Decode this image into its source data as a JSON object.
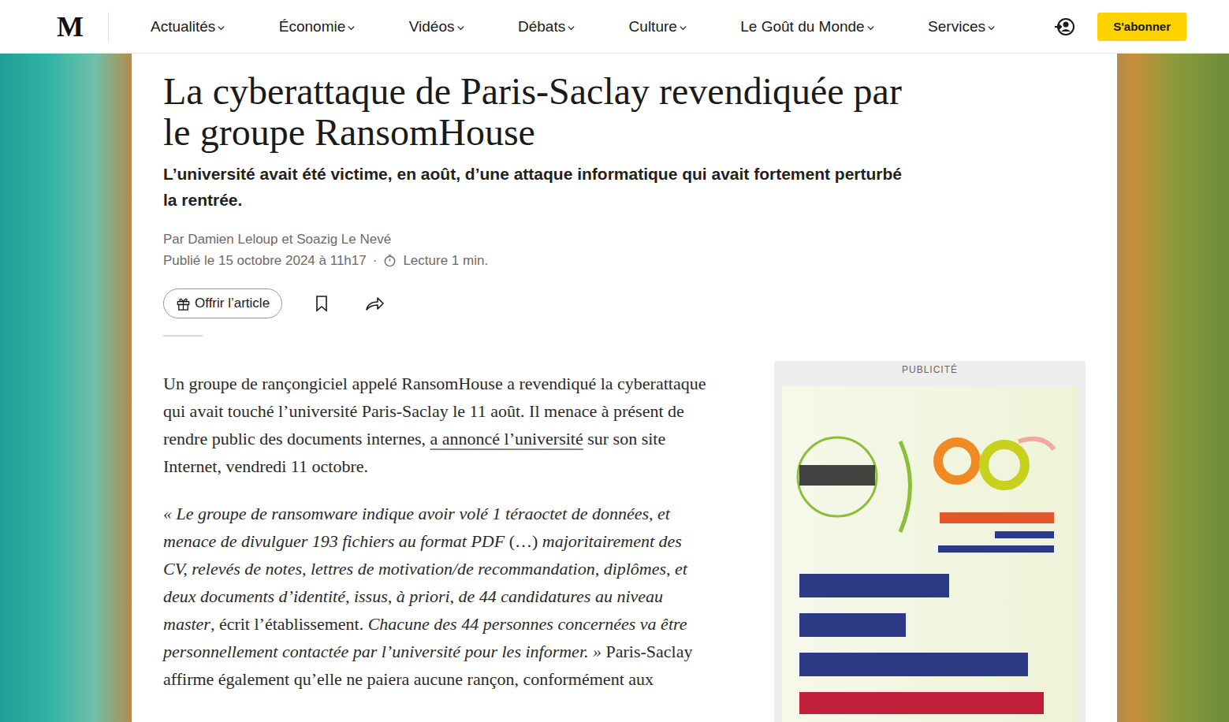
{
  "header": {
    "logo": "M",
    "nav": [
      {
        "label": "Actualités"
      },
      {
        "label": "Économie"
      },
      {
        "label": "Vidéos"
      },
      {
        "label": "Débats"
      },
      {
        "label": "Culture"
      },
      {
        "label": "Le Goût du Monde"
      },
      {
        "label": "Services"
      }
    ],
    "subscribe": "S'abonner"
  },
  "article": {
    "title": "La cyberattaque de Paris-Saclay revendiquée par le groupe RansomHouse",
    "subtitle": "L’université avait été victime, en août, d’une attaque informatique qui avait fortement perturbé la rentrée.",
    "byline": "Par Damien Leloup et Soazig Le Nevé",
    "published": "Publié le 15 octobre 2024 à 11h17",
    "separator": "·",
    "reading": "Lecture 1 min.",
    "gift": "Offrir l’article",
    "paragraphs": [
      {
        "runs": [
          {
            "kind": "plain",
            "text": "Un groupe de rançongiciel appelé RansomHouse a revendiqué la cyberattaque qui avait touché l’université Paris-Saclay le 11 août. Il menace à présent de rendre public des documents internes, "
          },
          {
            "kind": "link",
            "text": "a annoncé l’université"
          },
          {
            "kind": "plain",
            "text": " sur son site Internet, vendredi 11 octobre."
          }
        ]
      },
      {
        "runs": [
          {
            "kind": "italic",
            "text": "« Le groupe de ransomware indique avoir volé 1 téraoctet de données, et menace de divulguer 193 fichiers au format PDF "
          },
          {
            "kind": "plain",
            "text": "(…)"
          },
          {
            "kind": "italic",
            "text": " majoritairement des CV, relevés de notes, lettres de motivation/de recommandation, diplômes, et deux documents d’identité, issus, à priori, de 44 candidatures au niveau master"
          },
          {
            "kind": "plain",
            "text": ", écrit l’établissement. "
          },
          {
            "kind": "italic",
            "text": "Chacune des 44 personnes concernées va être personnellement contactée par l’université pour les informer. »"
          },
          {
            "kind": "plain",
            "text": " Paris-Saclay affirme également qu’elle ne paiera aucune rançon, conformément aux"
          }
        ]
      }
    ]
  },
  "ad": {
    "label": "PUBLICITÉ"
  }
}
